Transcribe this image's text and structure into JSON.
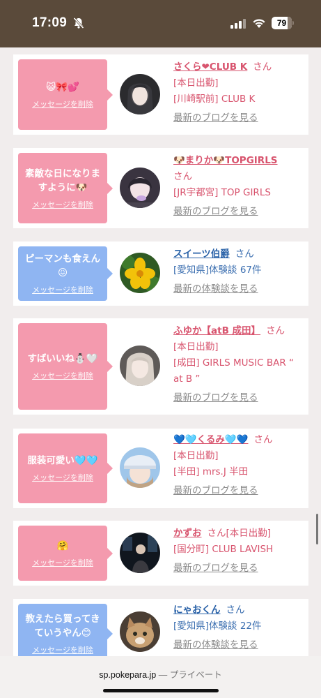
{
  "status": {
    "time": "17:09",
    "battery": "79",
    "battery_level": 0.79
  },
  "cards": [
    {
      "bubble_color": "pink",
      "message": "😺🎀💕",
      "delete_label": "メッセージを削除",
      "name": "さくら❤CLUB K",
      "name_color": "pink",
      "san": "さん",
      "lines": [
        "[本日出勤]",
        "[川崎駅前] CLUB K"
      ],
      "link": "最新のブログを見る"
    },
    {
      "bubble_color": "pink",
      "message": "素敵な日になりますように🐶",
      "delete_label": "メッセージを削除",
      "name": "🐶まりか🐶TOPGIRLS",
      "name_color": "pink",
      "san": "さん",
      "lines": [
        "[JR宇都宮] TOP GIRLS"
      ],
      "link": "最新のブログを見る"
    },
    {
      "bubble_color": "blue",
      "message": "ピーマンも食えん😖",
      "delete_label": "メッセージを削除",
      "name": "スイーツ伯爵",
      "name_color": "blue",
      "san": "さん",
      "lines": [
        "[愛知県]体験談 67件"
      ],
      "link": "最新の体験談を見る"
    },
    {
      "bubble_color": "pink",
      "message": "すばいいね⛄🤍",
      "delete_label": "メッセージを削除",
      "name": "ふゆか【atB 成田】",
      "name_color": "pink",
      "san": "さん",
      "lines": [
        "[本日出勤]",
        "[成田] GIRLS MUSIC BAR “ at B ”"
      ],
      "link": "最新のブログを見る"
    },
    {
      "bubble_color": "pink",
      "message": "服装可愛い🩵🩵",
      "delete_label": "メッセージを削除",
      "name": "💙🩵くるみ🩵💙",
      "name_color": "pink",
      "san": "さん",
      "lines": [
        "[本日出勤]",
        "[半田] mrs.J 半田"
      ],
      "link": "最新のブログを見る"
    },
    {
      "bubble_color": "pink",
      "message": "🤗",
      "delete_label": "メッセージを削除",
      "name": "かずお",
      "name_color": "pink",
      "san": "さん[本日出勤]",
      "lines": [
        "[国分町] CLUB LAVISH"
      ],
      "link": "最新のブログを見る"
    },
    {
      "bubble_color": "blue",
      "message": "教えたら買ってきていうやん😊",
      "delete_label": "メッセージを削除",
      "name": "にゃおくん",
      "name_color": "blue",
      "san": "さん",
      "lines": [
        "[愛知県]体験談 22件"
      ],
      "link": "最新の体験談を見る"
    }
  ],
  "browser": {
    "url": "sp.pokepara.jp",
    "separator": " — ",
    "mode": "プライベート"
  }
}
